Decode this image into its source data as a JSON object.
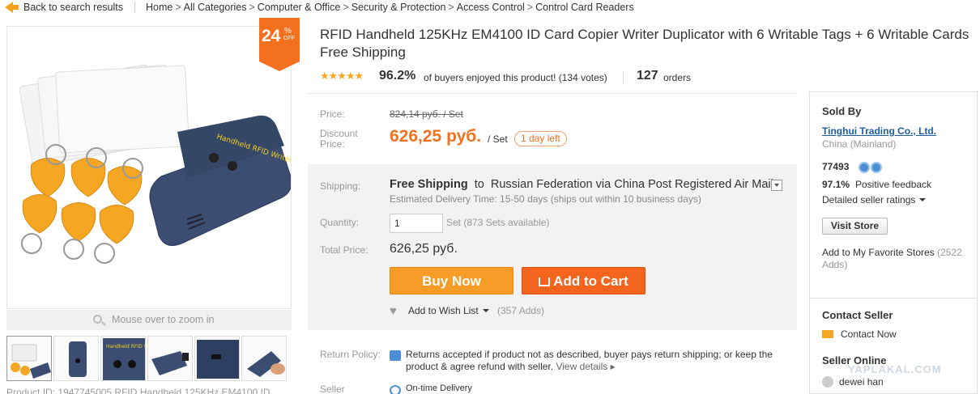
{
  "breadcrumb": {
    "back_label": "Back to search results",
    "path": [
      "Home",
      "All Categories",
      "Computer & Office",
      "Security & Protection",
      "Access Control",
      "Control Card Readers"
    ],
    "separator": ">"
  },
  "gallery": {
    "discount_num": "24",
    "discount_pct": "%",
    "discount_off": "OFF",
    "zoom_hint": "Mouse over to zoom in",
    "thumbnail_count": 6,
    "product_id_text": "Product ID: 1947745005 RFID Handheld 125KHz EM4100 ID"
  },
  "product": {
    "title": "RFID Handheld 125KHz EM4100 ID Card Copier Writer Duplicator with 6 Writable Tags + 6 Writable Cards Free Shipping",
    "rating_pct": "96.2%",
    "rating_text": "of buyers enjoyed this product! (134 votes)",
    "orders_num": "127",
    "orders_label": "orders"
  },
  "price": {
    "orig_label": "Price:",
    "orig_value": "824,14 руб. / Set",
    "disc_label_1": "Discount",
    "disc_label_2": "Price:",
    "disc_value": "626,25 руб.",
    "disc_unit": "/ Set",
    "time_left": "1 day left"
  },
  "shipping": {
    "label": "Shipping:",
    "free": "Free Shipping",
    "to": "to",
    "destination": "Russian Federation via China Post Registered Air Mail",
    "estimate": "Estimated Delivery Time: 15-50 days (ships out within 10 business days)"
  },
  "quantity": {
    "label": "Quantity:",
    "value": "1",
    "available": "Set (873 Sets available)"
  },
  "total": {
    "label": "Total Price:",
    "value": "626,25 руб."
  },
  "actions": {
    "buy_now": "Buy Now",
    "add_to_cart": "Add to Cart",
    "wish_list": "Add to Wish List",
    "wish_count": "(357 Adds)"
  },
  "policy": {
    "return_label": "Return Policy:",
    "return_text": "Returns accepted if product not as described, buyer pays return shipping; or keep the product & agree refund with seller.",
    "view_details": "View details",
    "seller_label": "Seller",
    "ontime": "On-time Delivery"
  },
  "seller": {
    "sold_by": "Sold By",
    "store_name": "Tinghui Trading Co., Ltd.",
    "country": "China (Mainland)",
    "score": "77493",
    "feedback_pct": "97.1%",
    "feedback_text": "Positive feedback",
    "detailed_ratings": "Detailed seller ratings",
    "visit_store": "Visit Store",
    "favorite": "Add to My Favorite Stores",
    "favorite_count": "(2522 Adds)"
  },
  "contact": {
    "title": "Contact Seller",
    "contact_now": "Contact Now",
    "online_title": "Seller Online",
    "online_name": "dewei han"
  },
  "watermark": "YAPLAKAL.COM",
  "colors": {
    "accent_orange": "#f3711e",
    "buy_now": "#f89c28",
    "link_blue": "#1c5ea5",
    "star": "#f5a623"
  }
}
